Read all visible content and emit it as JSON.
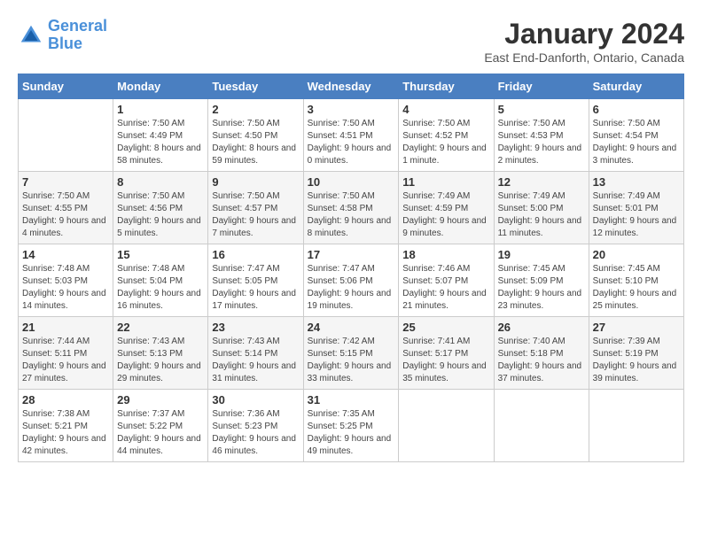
{
  "logo": {
    "line1": "General",
    "line2": "Blue"
  },
  "title": "January 2024",
  "location": "East End-Danforth, Ontario, Canada",
  "days_of_week": [
    "Sunday",
    "Monday",
    "Tuesday",
    "Wednesday",
    "Thursday",
    "Friday",
    "Saturday"
  ],
  "weeks": [
    [
      {
        "day": "",
        "sunrise": "",
        "sunset": "",
        "daylight": ""
      },
      {
        "day": "1",
        "sunrise": "Sunrise: 7:50 AM",
        "sunset": "Sunset: 4:49 PM",
        "daylight": "Daylight: 8 hours and 58 minutes."
      },
      {
        "day": "2",
        "sunrise": "Sunrise: 7:50 AM",
        "sunset": "Sunset: 4:50 PM",
        "daylight": "Daylight: 8 hours and 59 minutes."
      },
      {
        "day": "3",
        "sunrise": "Sunrise: 7:50 AM",
        "sunset": "Sunset: 4:51 PM",
        "daylight": "Daylight: 9 hours and 0 minutes."
      },
      {
        "day": "4",
        "sunrise": "Sunrise: 7:50 AM",
        "sunset": "Sunset: 4:52 PM",
        "daylight": "Daylight: 9 hours and 1 minute."
      },
      {
        "day": "5",
        "sunrise": "Sunrise: 7:50 AM",
        "sunset": "Sunset: 4:53 PM",
        "daylight": "Daylight: 9 hours and 2 minutes."
      },
      {
        "day": "6",
        "sunrise": "Sunrise: 7:50 AM",
        "sunset": "Sunset: 4:54 PM",
        "daylight": "Daylight: 9 hours and 3 minutes."
      }
    ],
    [
      {
        "day": "7",
        "sunrise": "Sunrise: 7:50 AM",
        "sunset": "Sunset: 4:55 PM",
        "daylight": "Daylight: 9 hours and 4 minutes."
      },
      {
        "day": "8",
        "sunrise": "Sunrise: 7:50 AM",
        "sunset": "Sunset: 4:56 PM",
        "daylight": "Daylight: 9 hours and 5 minutes."
      },
      {
        "day": "9",
        "sunrise": "Sunrise: 7:50 AM",
        "sunset": "Sunset: 4:57 PM",
        "daylight": "Daylight: 9 hours and 7 minutes."
      },
      {
        "day": "10",
        "sunrise": "Sunrise: 7:50 AM",
        "sunset": "Sunset: 4:58 PM",
        "daylight": "Daylight: 9 hours and 8 minutes."
      },
      {
        "day": "11",
        "sunrise": "Sunrise: 7:49 AM",
        "sunset": "Sunset: 4:59 PM",
        "daylight": "Daylight: 9 hours and 9 minutes."
      },
      {
        "day": "12",
        "sunrise": "Sunrise: 7:49 AM",
        "sunset": "Sunset: 5:00 PM",
        "daylight": "Daylight: 9 hours and 11 minutes."
      },
      {
        "day": "13",
        "sunrise": "Sunrise: 7:49 AM",
        "sunset": "Sunset: 5:01 PM",
        "daylight": "Daylight: 9 hours and 12 minutes."
      }
    ],
    [
      {
        "day": "14",
        "sunrise": "Sunrise: 7:48 AM",
        "sunset": "Sunset: 5:03 PM",
        "daylight": "Daylight: 9 hours and 14 minutes."
      },
      {
        "day": "15",
        "sunrise": "Sunrise: 7:48 AM",
        "sunset": "Sunset: 5:04 PM",
        "daylight": "Daylight: 9 hours and 16 minutes."
      },
      {
        "day": "16",
        "sunrise": "Sunrise: 7:47 AM",
        "sunset": "Sunset: 5:05 PM",
        "daylight": "Daylight: 9 hours and 17 minutes."
      },
      {
        "day": "17",
        "sunrise": "Sunrise: 7:47 AM",
        "sunset": "Sunset: 5:06 PM",
        "daylight": "Daylight: 9 hours and 19 minutes."
      },
      {
        "day": "18",
        "sunrise": "Sunrise: 7:46 AM",
        "sunset": "Sunset: 5:07 PM",
        "daylight": "Daylight: 9 hours and 21 minutes."
      },
      {
        "day": "19",
        "sunrise": "Sunrise: 7:45 AM",
        "sunset": "Sunset: 5:09 PM",
        "daylight": "Daylight: 9 hours and 23 minutes."
      },
      {
        "day": "20",
        "sunrise": "Sunrise: 7:45 AM",
        "sunset": "Sunset: 5:10 PM",
        "daylight": "Daylight: 9 hours and 25 minutes."
      }
    ],
    [
      {
        "day": "21",
        "sunrise": "Sunrise: 7:44 AM",
        "sunset": "Sunset: 5:11 PM",
        "daylight": "Daylight: 9 hours and 27 minutes."
      },
      {
        "day": "22",
        "sunrise": "Sunrise: 7:43 AM",
        "sunset": "Sunset: 5:13 PM",
        "daylight": "Daylight: 9 hours and 29 minutes."
      },
      {
        "day": "23",
        "sunrise": "Sunrise: 7:43 AM",
        "sunset": "Sunset: 5:14 PM",
        "daylight": "Daylight: 9 hours and 31 minutes."
      },
      {
        "day": "24",
        "sunrise": "Sunrise: 7:42 AM",
        "sunset": "Sunset: 5:15 PM",
        "daylight": "Daylight: 9 hours and 33 minutes."
      },
      {
        "day": "25",
        "sunrise": "Sunrise: 7:41 AM",
        "sunset": "Sunset: 5:17 PM",
        "daylight": "Daylight: 9 hours and 35 minutes."
      },
      {
        "day": "26",
        "sunrise": "Sunrise: 7:40 AM",
        "sunset": "Sunset: 5:18 PM",
        "daylight": "Daylight: 9 hours and 37 minutes."
      },
      {
        "day": "27",
        "sunrise": "Sunrise: 7:39 AM",
        "sunset": "Sunset: 5:19 PM",
        "daylight": "Daylight: 9 hours and 39 minutes."
      }
    ],
    [
      {
        "day": "28",
        "sunrise": "Sunrise: 7:38 AM",
        "sunset": "Sunset: 5:21 PM",
        "daylight": "Daylight: 9 hours and 42 minutes."
      },
      {
        "day": "29",
        "sunrise": "Sunrise: 7:37 AM",
        "sunset": "Sunset: 5:22 PM",
        "daylight": "Daylight: 9 hours and 44 minutes."
      },
      {
        "day": "30",
        "sunrise": "Sunrise: 7:36 AM",
        "sunset": "Sunset: 5:23 PM",
        "daylight": "Daylight: 9 hours and 46 minutes."
      },
      {
        "day": "31",
        "sunrise": "Sunrise: 7:35 AM",
        "sunset": "Sunset: 5:25 PM",
        "daylight": "Daylight: 9 hours and 49 minutes."
      },
      {
        "day": "",
        "sunrise": "",
        "sunset": "",
        "daylight": ""
      },
      {
        "day": "",
        "sunrise": "",
        "sunset": "",
        "daylight": ""
      },
      {
        "day": "",
        "sunrise": "",
        "sunset": "",
        "daylight": ""
      }
    ]
  ]
}
